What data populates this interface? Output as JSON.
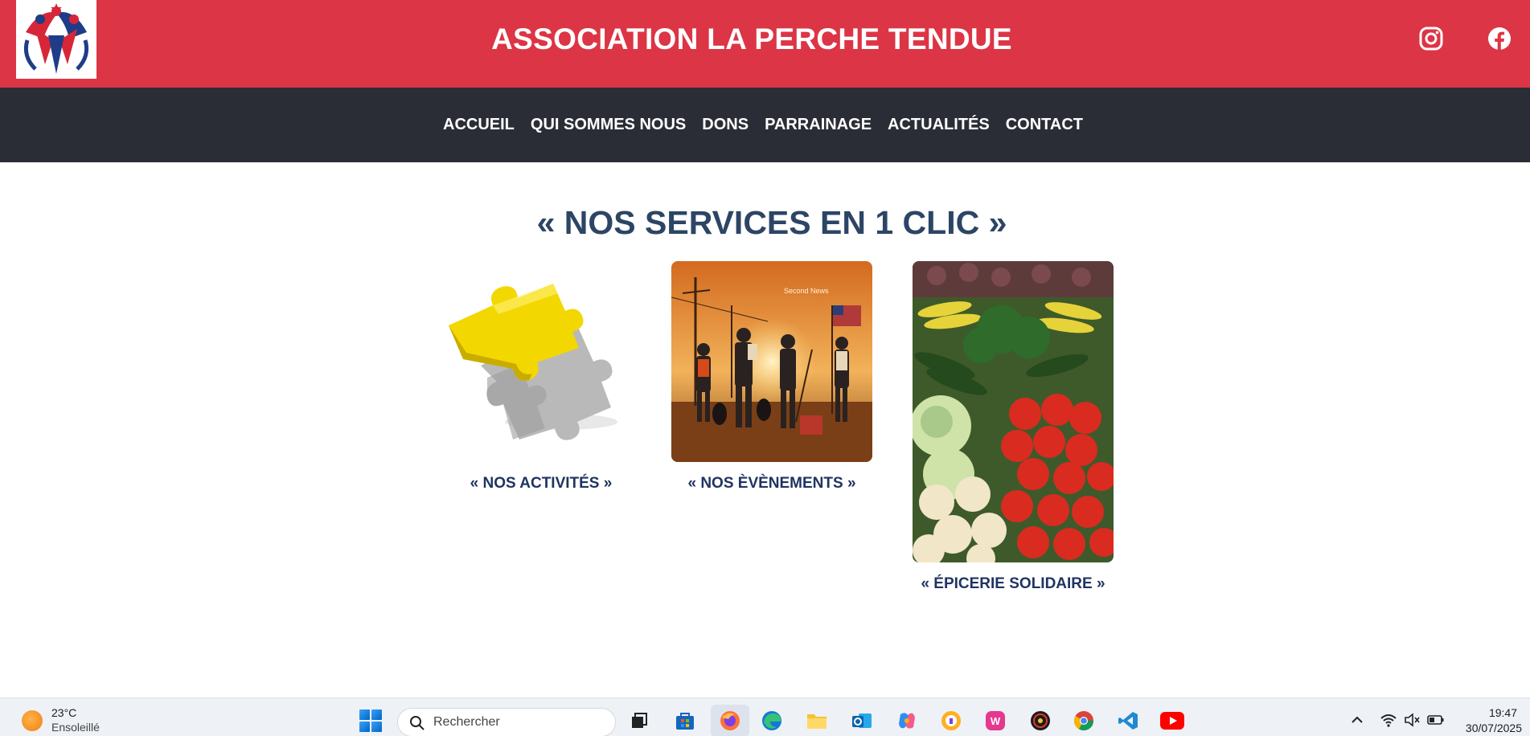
{
  "header": {
    "title": "ASSOCIATION LA PERCHE TENDUE",
    "logo_icon": "association-logo",
    "social": [
      {
        "name": "instagram-icon"
      },
      {
        "name": "facebook-icon"
      }
    ],
    "background": "#dc3545"
  },
  "nav": {
    "background": "#2b2d36",
    "items": [
      {
        "label": "ACCUEIL"
      },
      {
        "label": "QUI SOMMES NOUS"
      },
      {
        "label": "DONS"
      },
      {
        "label": "PARRAINAGE"
      },
      {
        "label": "ACTUALITÉS"
      },
      {
        "label": "CONTACT"
      }
    ]
  },
  "services": {
    "title": "« NOS SERVICES EN 1 CLIC »",
    "cards": [
      {
        "label": "« NOS ACTIVITÉS »",
        "image": "puzzle-pieces-image"
      },
      {
        "label": "« NOS ÈVÈNEMENTS »",
        "image": "volunteers-illustration-image",
        "image_caption": "Second News"
      },
      {
        "label": "« ÉPICERIE SOLIDAIRE »",
        "image": "vegetable-market-image"
      }
    ]
  },
  "taskbar": {
    "weather": {
      "temp": "23°C",
      "desc": "Ensoleillé",
      "icon": "sun-icon"
    },
    "search_placeholder": "Rechercher",
    "apps": [
      "task-view-icon",
      "store-icon",
      "firefox-icon",
      "edge-icon",
      "file-explorer-icon",
      "outlook-icon",
      "copilot-icon",
      "vpn-icon",
      "wamp-icon",
      "radio-icon",
      "chrome-icon",
      "vscode-icon",
      "youtube-icon"
    ],
    "clock": {
      "time": "19:47",
      "date": "30/07/2025"
    }
  }
}
